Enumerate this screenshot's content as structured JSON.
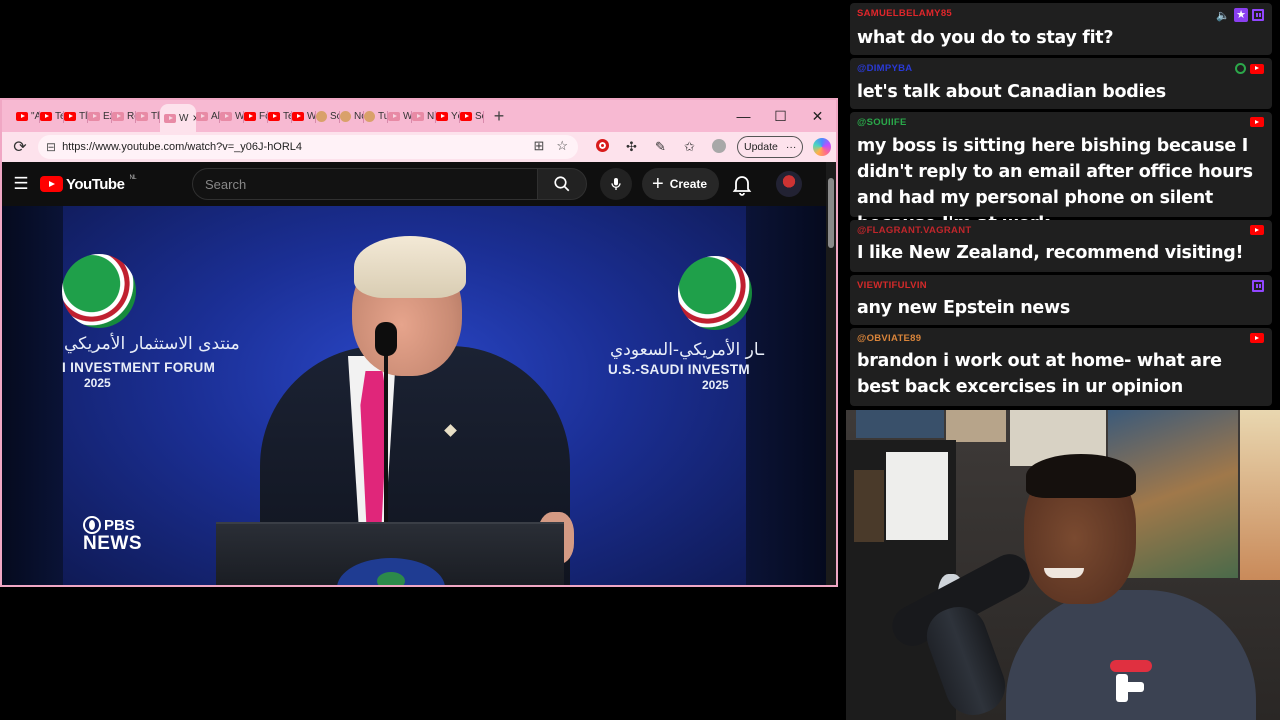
{
  "browser": {
    "tabs": [
      {
        "label": "\"A",
        "kind": "yt"
      },
      {
        "label": "Te",
        "kind": "yt"
      },
      {
        "label": "Tl",
        "kind": "yt"
      },
      {
        "label": "Ex",
        "kind": "dim"
      },
      {
        "label": "Re",
        "kind": "dim"
      },
      {
        "label": "Tl",
        "kind": "dim"
      },
      {
        "label": "W",
        "kind": "dim",
        "active": true
      },
      {
        "label": "Al",
        "kind": "dim"
      },
      {
        "label": "W",
        "kind": "dim"
      },
      {
        "label": "Fc",
        "kind": "yt"
      },
      {
        "label": "Te",
        "kind": "yt"
      },
      {
        "label": "W",
        "kind": "yt"
      },
      {
        "label": "Sc",
        "kind": "round"
      },
      {
        "label": "Nc",
        "kind": "round"
      },
      {
        "label": "Tu",
        "kind": "round"
      },
      {
        "label": "W",
        "kind": "dim"
      },
      {
        "label": "Ni",
        "kind": "dim"
      },
      {
        "label": "Yc",
        "kind": "yt"
      },
      {
        "label": "Sc",
        "kind": "yt"
      }
    ],
    "active_tab_close": "×",
    "new_tab": "+",
    "window_controls": {
      "minimize": "—",
      "maximize": "☐",
      "close": "✕"
    },
    "url": "https://www.youtube.com/watch?v=_y06J-hORL4",
    "update_label": "Update",
    "more_label": "···"
  },
  "youtube": {
    "logo_text": "YouTube",
    "region": "NL",
    "search_placeholder": "Search",
    "create_label": "Create",
    "video": {
      "forum_arabic_left": "منتدى الاستثمار الأمريكي",
      "forum_english_left": "I INVESTMENT FORUM",
      "forum_year_left": "2025",
      "forum_arabic_right": "ـار الأمريكي-السعودي",
      "forum_english_right": "U.S.-SAUDI INVESTM",
      "forum_year_right": "2025",
      "channel_logo_line1": "PBS",
      "channel_logo_line2": "NEWS"
    }
  },
  "chat": {
    "messages": [
      {
        "user": "SAMUELBELAMY85",
        "user_color": "#e0262b",
        "text": "what do you do to stay fit?",
        "icons": [
          "mute",
          "star",
          "twitch"
        ]
      },
      {
        "user": "@DIMPYBA",
        "user_color": "#2a3ad6",
        "text": "let's talk about Canadian bodies",
        "icons": [
          "badge",
          "youtube"
        ]
      },
      {
        "user": "@SOUIIFE",
        "user_color": "#2aa84a",
        "text": "my boss is sitting here bishing because I didn't reply to an email after office hours and had my personal phone on silent because I'm at work",
        "icons": [
          "youtube"
        ]
      },
      {
        "user": "@FLAGRANT.VAGRANT",
        "user_color": "#c0262b",
        "text": "I like New Zealand, recommend visiting!",
        "icons": [
          "youtube"
        ]
      },
      {
        "user": "VIEWTIFULVIN",
        "user_color": "#d42a2a",
        "text": "any new Epstein news",
        "icons": [
          "twitch"
        ]
      },
      {
        "user": "@OBVIATE89",
        "user_color": "#d9843a",
        "text": "brandon i work out at home- what are best back excercises in ur opinion",
        "icons": [
          "youtube"
        ]
      }
    ]
  }
}
